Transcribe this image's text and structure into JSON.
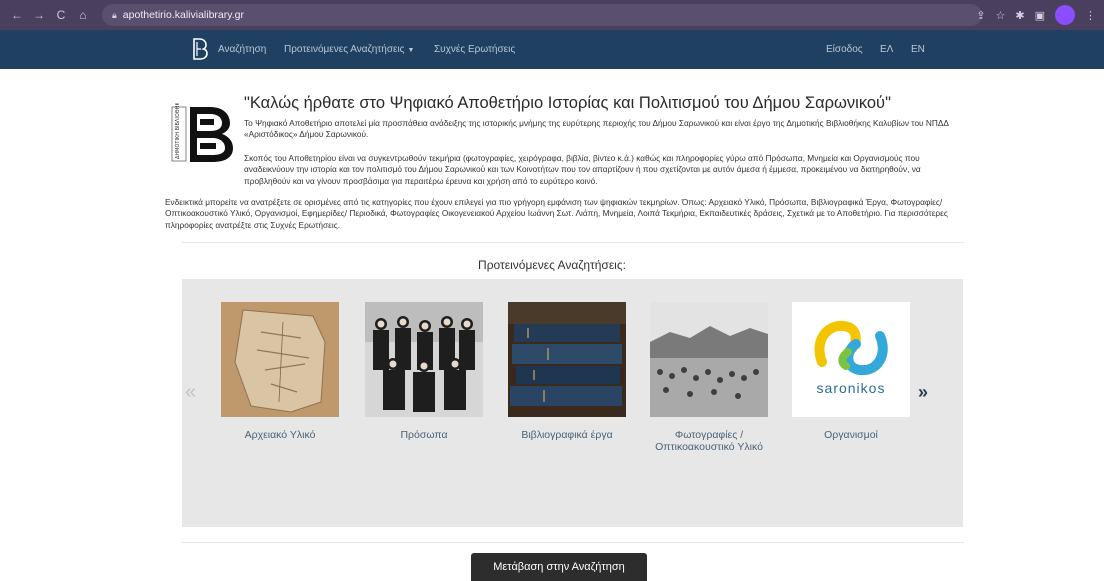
{
  "browser": {
    "url": "apothetirio.kalivialibrary.gr"
  },
  "nav": {
    "search": "Αναζήτηση",
    "suggested": "Προτεινόμενες Αναζητήσεις",
    "faq": "Συχνές Ερωτήσεις",
    "login": "Είσοδος",
    "lang_el": "ΕΛ",
    "lang_en": "EN"
  },
  "intro": {
    "title": "\"Καλώς ήρθατε στο Ψηφιακό Αποθετήριο Ιστορίας και Πολιτισμού του Δήμου Σαρωνικού\"",
    "p1": "Το Ψηφιακό Αποθετήριο αποτελεί μία προσπάθεια ανάδειξης της ιστορικής μνήμης της ευρύτερης περιοχής του Δήμου Σαρωνικού και είναι έργο της Δημοτικής Βιβλιοθήκης Καλυβίων του ΝΠΔΔ «Αριστόδικος» Δήμου Σαρωνικού.",
    "p2": "Σκοπός του Αποθετηρίου είναι να συγκεντρωθούν τεκμήρια (φωτογραφίες, χειρόγραφα, βιβλία, βίντεο κ.ά.) καθώς και πληροφορίες γύρω από Πρόσωπα, Μνημεία και Οργανισμούς που αναδεικνύουν την ιστορία και τον πολιτισμό του Δήμου Σαρωνικού και των Κοινοτήτων που τον απαρτίζουν ή που σχετίζονται με αυτόν άμεσα ή έμμεσα, προκειμένου να διατηρηθούν, να προβληθούν και να γίνουν προσβάσιμα για περαιτέρω έρευνα και χρήση από το ευρύτερο κοινό.",
    "p3": "Ενδεικτικά μπορείτε να ανατρέξετε σε ορισμένες από τις κατηγορίες που έχουν επιλεγεί για πιο γρήγορη εμφάνιση των ψηφιακών τεκμηρίων. Όπως: Αρχειακό Υλικό, Πρόσωπα, Βιβλιογραφικά Έργα, Φωτογραφίες/ Οπτικοακουστικό Υλικό, Οργανισμοί, Εφημερίδες/ Περιοδικά, Φωτογραφίες Οικογενειακού Αρχείου Ιωάννη Σωτ. Λιάπη, Μνημεία, Λοιπά Τεκμήρια, Εκπαιδευτικές δράσεις, Σχετικά με το Αποθετήριο. Για περισσότερες πληροφορίες ανατρέξτε στις Συχνές Ερωτήσεις."
  },
  "suggestions": {
    "title": "Προτεινόμενες Αναζητήσεις:",
    "items": [
      {
        "label": "Αρχειακό Υλικό"
      },
      {
        "label": "Πρόσωπα"
      },
      {
        "label": "Βιβλιογραφικά έργα"
      },
      {
        "label": "Φωτογραφίες / Οπτικοακουστικό Υλικό"
      },
      {
        "label": "Οργανισμοί"
      }
    ],
    "prev": "«",
    "next": "»",
    "saronikos_logo_text": "saronikos"
  },
  "cta": {
    "label": "Μετάβαση στην Αναζήτηση"
  },
  "colors": {
    "chrome": "#4a3f5c",
    "nav": "#1f4060",
    "carousel_bg": "#e7e7e7",
    "button": "#2d2d2d"
  }
}
